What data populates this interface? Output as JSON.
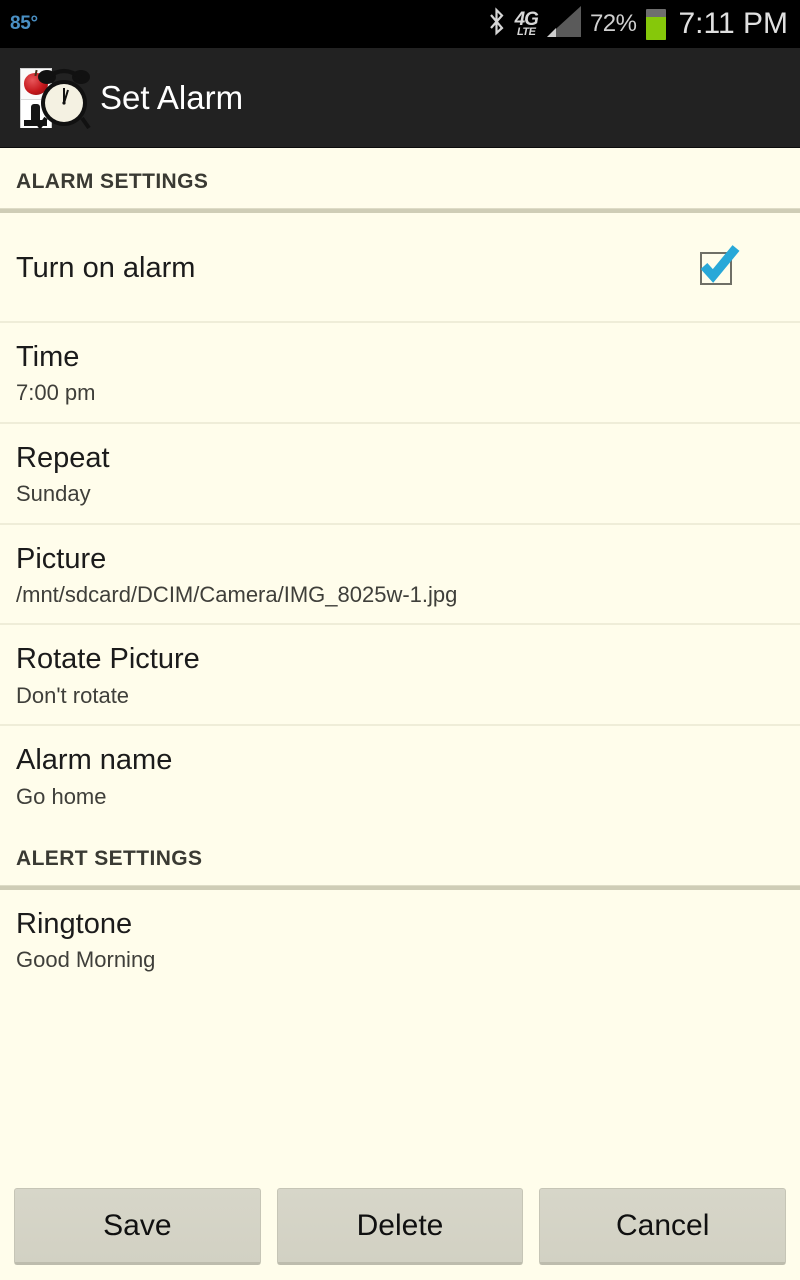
{
  "statusbar": {
    "temperature": "85°",
    "bluetooth_icon": "bluetooth-icon",
    "network_type": "4G",
    "network_sub": "LTE",
    "signal_icon": "signal-bars-icon",
    "battery_percent": "72%",
    "battery_icon": "battery-icon",
    "battery_level": 72,
    "clock": "7:11 PM"
  },
  "actionbar": {
    "app_icon": "alarm-clock-photo-icon",
    "title": "Set Alarm"
  },
  "sections": [
    {
      "header": "ALARM SETTINGS",
      "rows": [
        {
          "title": "Turn on alarm",
          "sub": "",
          "control": "checkbox",
          "checked": true
        },
        {
          "title": "Time",
          "sub": "7:00 pm"
        },
        {
          "title": "Repeat",
          "sub": "Sunday"
        },
        {
          "title": "Picture",
          "sub": "/mnt/sdcard/DCIM/Camera/IMG_8025w-1.jpg"
        },
        {
          "title": "Rotate Picture",
          "sub": "Don't rotate"
        },
        {
          "title": "Alarm name",
          "sub": "Go home"
        }
      ]
    },
    {
      "header": "ALERT SETTINGS",
      "rows": [
        {
          "title": "Ringtone",
          "sub": "Good Morning"
        }
      ]
    }
  ],
  "buttons": {
    "save": "Save",
    "delete": "Delete",
    "cancel": "Cancel"
  },
  "colors": {
    "background": "#FFFDEB",
    "actionbar": "#222222",
    "statusbar": "#000000",
    "checkbox_accent": "#28A8D8",
    "battery_green": "#86C80A",
    "temperature_blue": "#4A90C4",
    "divider_thick": "#CFCDB6",
    "divider_thin": "#EFEDD8",
    "button_face": "#D3D2C5"
  }
}
